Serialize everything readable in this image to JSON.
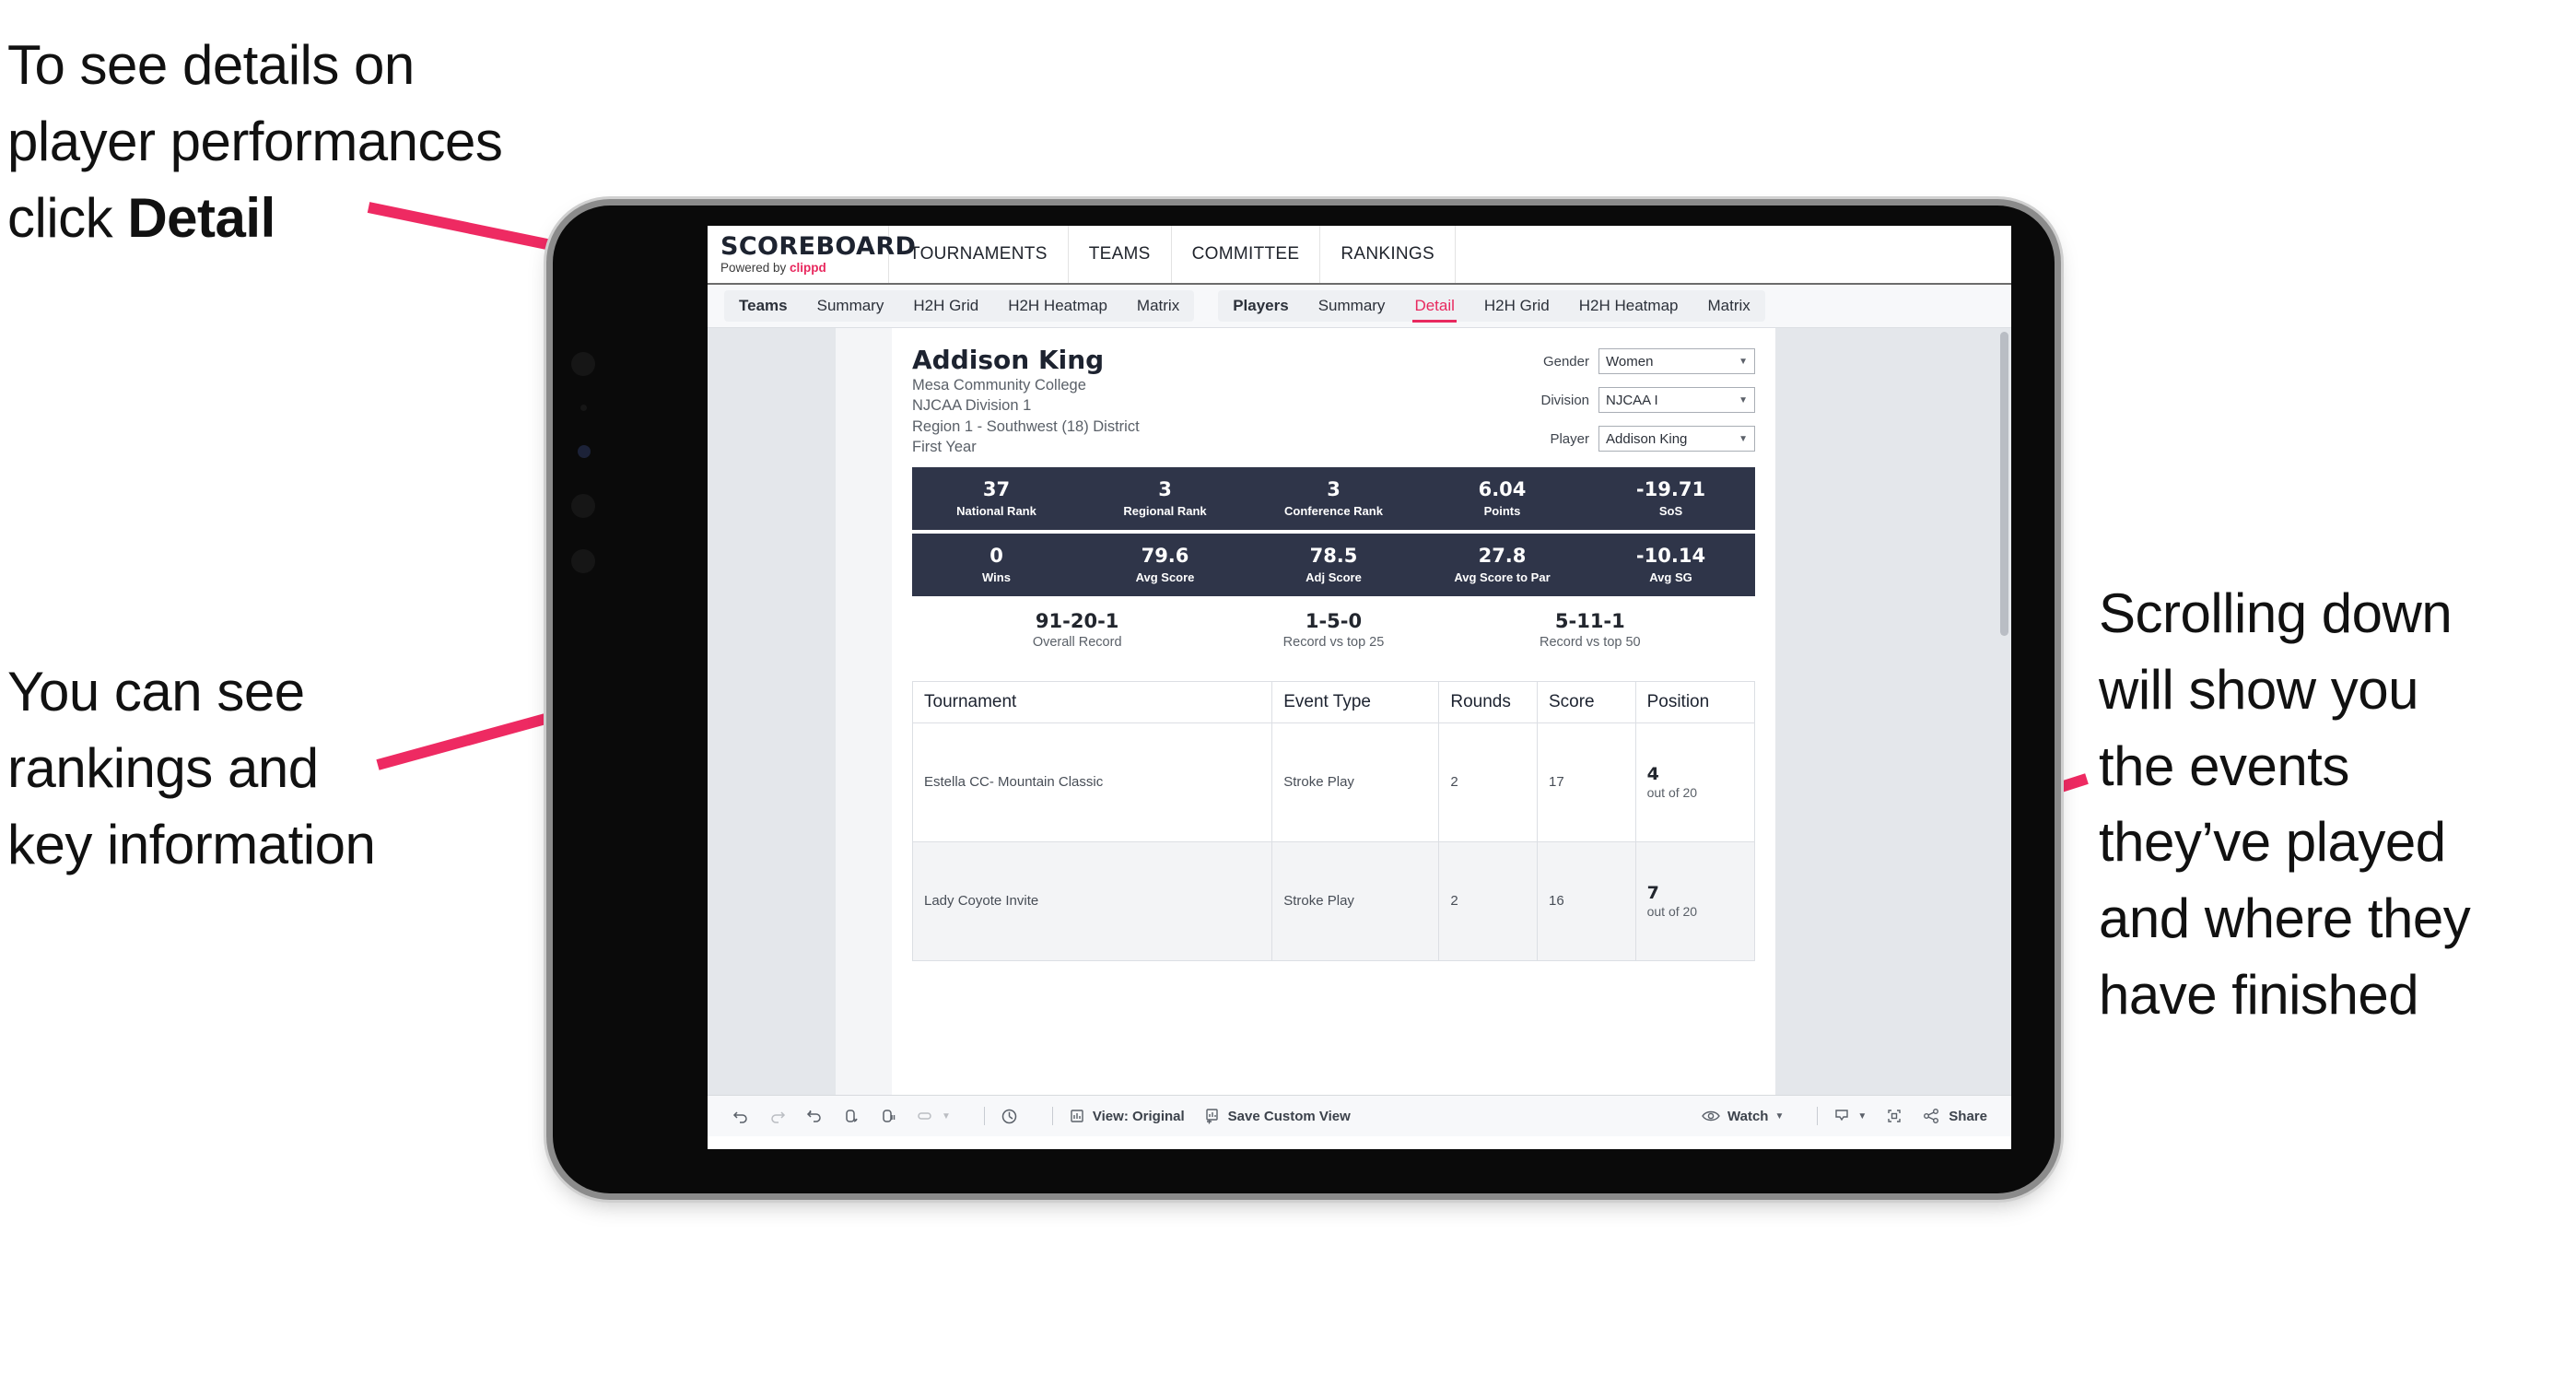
{
  "annotations": {
    "detail": "To see details on\nplayer performances\nclick ",
    "detail_bold": "Detail",
    "rankings": "You can see\nrankings and\nkey information",
    "scrolling": "Scrolling down\nwill show you\nthe events\nthey’ve played\nand where they\nhave finished"
  },
  "colors": {
    "accent_pink": "#e8285e",
    "stat_bar_navy": "#2f3549",
    "arrow_pink": "#ee2a62"
  },
  "app": {
    "brand": {
      "title": "SCOREBOARD",
      "powered_prefix": "Powered by ",
      "powered_name": "clippd"
    },
    "topnav": [
      {
        "label": "TOURNAMENTS"
      },
      {
        "label": "TEAMS"
      },
      {
        "label": "COMMITTEE"
      },
      {
        "label": "RANKINGS"
      }
    ],
    "subnav": {
      "group_teams": {
        "label": "Teams",
        "tabs": [
          "Summary",
          "H2H Grid",
          "H2H Heatmap",
          "Matrix"
        ]
      },
      "group_players": {
        "label": "Players",
        "tabs": [
          "Summary",
          "Detail",
          "H2H Grid",
          "H2H Heatmap",
          "Matrix"
        ],
        "active": "Detail"
      }
    },
    "player": {
      "name": "Addison King",
      "school": "Mesa Community College",
      "division": "NJCAA Division 1",
      "region": "Region 1 - Southwest (18) District",
      "year": "First Year"
    },
    "filters": [
      {
        "label": "Gender",
        "value": "Women"
      },
      {
        "label": "Division",
        "value": "NJCAA I"
      },
      {
        "label": "Player",
        "value": "Addison King"
      }
    ],
    "stats_row1": [
      {
        "value": "37",
        "label": "National Rank"
      },
      {
        "value": "3",
        "label": "Regional Rank"
      },
      {
        "value": "3",
        "label": "Conference Rank"
      },
      {
        "value": "6.04",
        "label": "Points"
      },
      {
        "value": "-19.71",
        "label": "SoS"
      }
    ],
    "stats_row2": [
      {
        "value": "0",
        "label": "Wins"
      },
      {
        "value": "79.6",
        "label": "Avg Score"
      },
      {
        "value": "78.5",
        "label": "Adj Score"
      },
      {
        "value": "27.8",
        "label": "Avg Score to Par"
      },
      {
        "value": "-10.14",
        "label": "Avg SG"
      }
    ],
    "records": [
      {
        "value": "91-20-1",
        "label": "Overall Record"
      },
      {
        "value": "1-5-0",
        "label": "Record vs top 25"
      },
      {
        "value": "5-11-1",
        "label": "Record vs top 50"
      }
    ],
    "table": {
      "headers": [
        "Tournament",
        "Event Type",
        "Rounds",
        "Score",
        "Position"
      ],
      "rows": [
        {
          "tournament": "Estella CC- Mountain Classic",
          "event_type": "Stroke Play",
          "rounds": "2",
          "score": "17",
          "position_rank": "4",
          "position_outof": "out of 20"
        },
        {
          "tournament": "Lady Coyote Invite",
          "event_type": "Stroke Play",
          "rounds": "2",
          "score": "16",
          "position_rank": "7",
          "position_outof": "out of 20"
        }
      ]
    },
    "toolbar": {
      "view_label": "View: Original",
      "save_label": "Save Custom View",
      "watch_label": "Watch",
      "share_label": "Share"
    }
  }
}
